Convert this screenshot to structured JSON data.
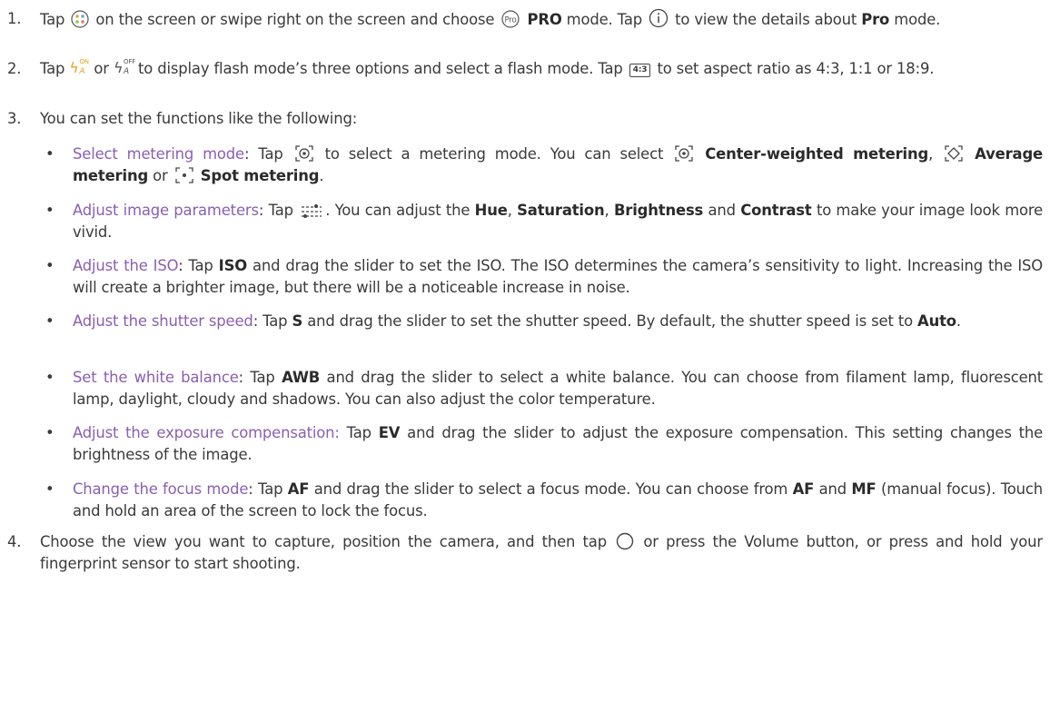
{
  "steps": [
    {
      "num": "1.",
      "parts": {
        "a": "Tap",
        "b": "on the screen or swipe right on the screen and choose",
        "pro_bold": "PRO",
        "c": "mode. Tap",
        "d": "to view the details about",
        "pro2_bold": "Pro",
        "e": "mode."
      }
    },
    {
      "num": "2.",
      "parts": {
        "a": "Tap",
        "b": "or",
        "c": "to display flash mode’s three options and select a flash mode. Tap",
        "badge": "4:3",
        "d": "to set aspect ratio as 4:3, 1:1 or 18:9."
      },
      "flash_on_sup": "ON",
      "flash_off_sup": "OFF",
      "flash_sub": "A"
    },
    {
      "num": "3.",
      "text": "You can set the functions like the following:"
    },
    {
      "num": "4.",
      "parts": {
        "a": "Choose the view you want to capture, position the camera, and then tap",
        "b": "or press the Volume button, or press and hold your fingerprint sensor to start shooting."
      }
    }
  ],
  "bullets": {
    "metering": {
      "title": "Select metering mode",
      "a": ": Tap",
      "b": "to select a metering mode. You can select",
      "center_bold": "Center-weighted metering",
      "c": ",",
      "average_bold": "Average metering",
      "d": "or",
      "spot_bold": "Spot metering",
      "e": "."
    },
    "image_params": {
      "title": "Adjust image parameters",
      "a": ": Tap",
      "b": ". You can adjust the",
      "hue": "Hue",
      "sep1": ",",
      "saturation": "Saturation",
      "sep2": ",",
      "brightness": "Brightness",
      "and": "and",
      "contrast": "Contrast",
      "c": "to make your image look more vivid."
    },
    "iso": {
      "title": "Adjust the ISO",
      "a": ": Tap",
      "iso_bold": "ISO",
      "b": "and drag the slider to set the ISO. The ISO determines the camera’s sensitivity to light. Increasing the ISO will create a brighter image, but there will be a noticeable increase in noise."
    },
    "shutter": {
      "title": "Adjust the shutter speed",
      "a": ": Tap",
      "s_bold": "S",
      "b": "and drag the slider to set the shutter speed. By default, the shutter speed is set to",
      "auto_bold": "Auto",
      "c": "."
    },
    "wb": {
      "title": "Set the white balance",
      "a": ": Tap",
      "awb_bold": "AWB",
      "b": "and drag the slider to select a white balance. You can choose from filament lamp, fluorescent lamp, daylight, cloudy and shadows. You can also adjust the color temperature."
    },
    "ev": {
      "title": "Adjust the exposure compensation:",
      "a": "Tap",
      "ev_bold": "EV",
      "b": "and drag the slider to adjust the exposure compensation. This setting changes the brightness of the image."
    },
    "focus": {
      "title": "Change the focus mode",
      "a": ": Tap",
      "af_bold": "AF",
      "b": "and drag the slider to select a focus mode. You can choose from",
      "af2_bold": "AF",
      "c": "and",
      "mf_bold": "MF",
      "d": "(manual focus). Touch and hold an area of the screen to lock the focus."
    }
  },
  "bullet_glyph": "•",
  "colors": {
    "link": "#8a5fb0",
    "text": "#3a3a3a",
    "flash_on": "#e5a224"
  },
  "icons": [
    "camera-modes-icon",
    "pro-mode-icon",
    "info-icon",
    "flash-on-icon",
    "flash-off-icon",
    "aspect-ratio-icon",
    "center-weighted-metering-icon",
    "average-metering-icon",
    "spot-metering-icon",
    "image-parameters-icon",
    "shutter-button-icon"
  ]
}
